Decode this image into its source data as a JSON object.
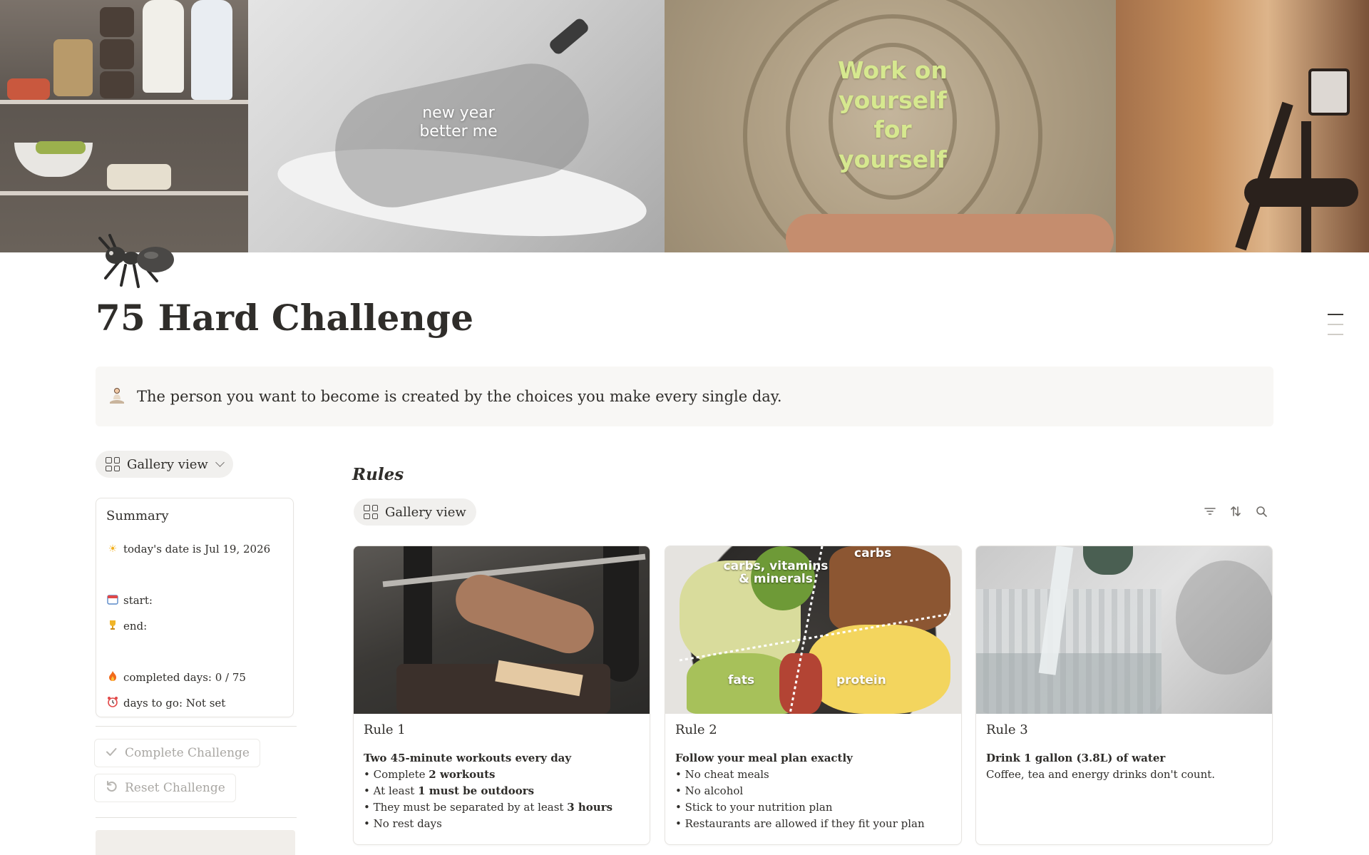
{
  "cover": {
    "caption_left": "new year better me",
    "caption_center": "Work on yourself for yourself"
  },
  "page": {
    "icon": "ant-icon",
    "title": "75 Hard Challenge"
  },
  "callout": {
    "icon": "meditating-person-icon",
    "text": "The person you want to become is created by the choices you make every single day."
  },
  "left_view": {
    "label": "Gallery view"
  },
  "summary": {
    "title": "Summary",
    "today": "today's date is Jul 19, 2026",
    "start": "start:",
    "end": "end:",
    "completed": "completed days: 0 / 75",
    "to_go": "days to go: Not set"
  },
  "actions": {
    "complete": "Complete Challenge",
    "reset": "Reset Challenge"
  },
  "rules": {
    "heading": "Rules",
    "view_label": "Gallery view",
    "cards": [
      {
        "title": "Rule 1",
        "image_labels": [],
        "headline": "Two 45-minute workouts every day",
        "bullets": [
          {
            "pre": "• Complete ",
            "bold": "2 workouts",
            "post": ""
          },
          {
            "pre": "• At least ",
            "bold": "1 must be outdoors",
            "post": ""
          },
          {
            "pre": "• They must be separated by at least ",
            "bold": "3 hours",
            "post": ""
          },
          {
            "pre": "• No rest days",
            "bold": "",
            "post": ""
          }
        ]
      },
      {
        "title": "Rule 2",
        "image_labels": [
          "carbs, vitamins & minerals",
          "carbs",
          "fats",
          "protein"
        ],
        "headline": "Follow your meal plan exactly",
        "bullets": [
          {
            "pre": "• No cheat meals",
            "bold": "",
            "post": ""
          },
          {
            "pre": "• No alcohol",
            "bold": "",
            "post": ""
          },
          {
            "pre": "• Stick to your nutrition plan",
            "bold": "",
            "post": ""
          },
          {
            "pre": "• Restaurants are allowed if they fit your plan",
            "bold": "",
            "post": ""
          }
        ]
      },
      {
        "title": "Rule 3",
        "image_labels": [],
        "headline": "Drink 1 gallon (3.8L) of water",
        "plain": "Coffee, tea and energy drinks don't count.",
        "bullets": []
      }
    ]
  }
}
